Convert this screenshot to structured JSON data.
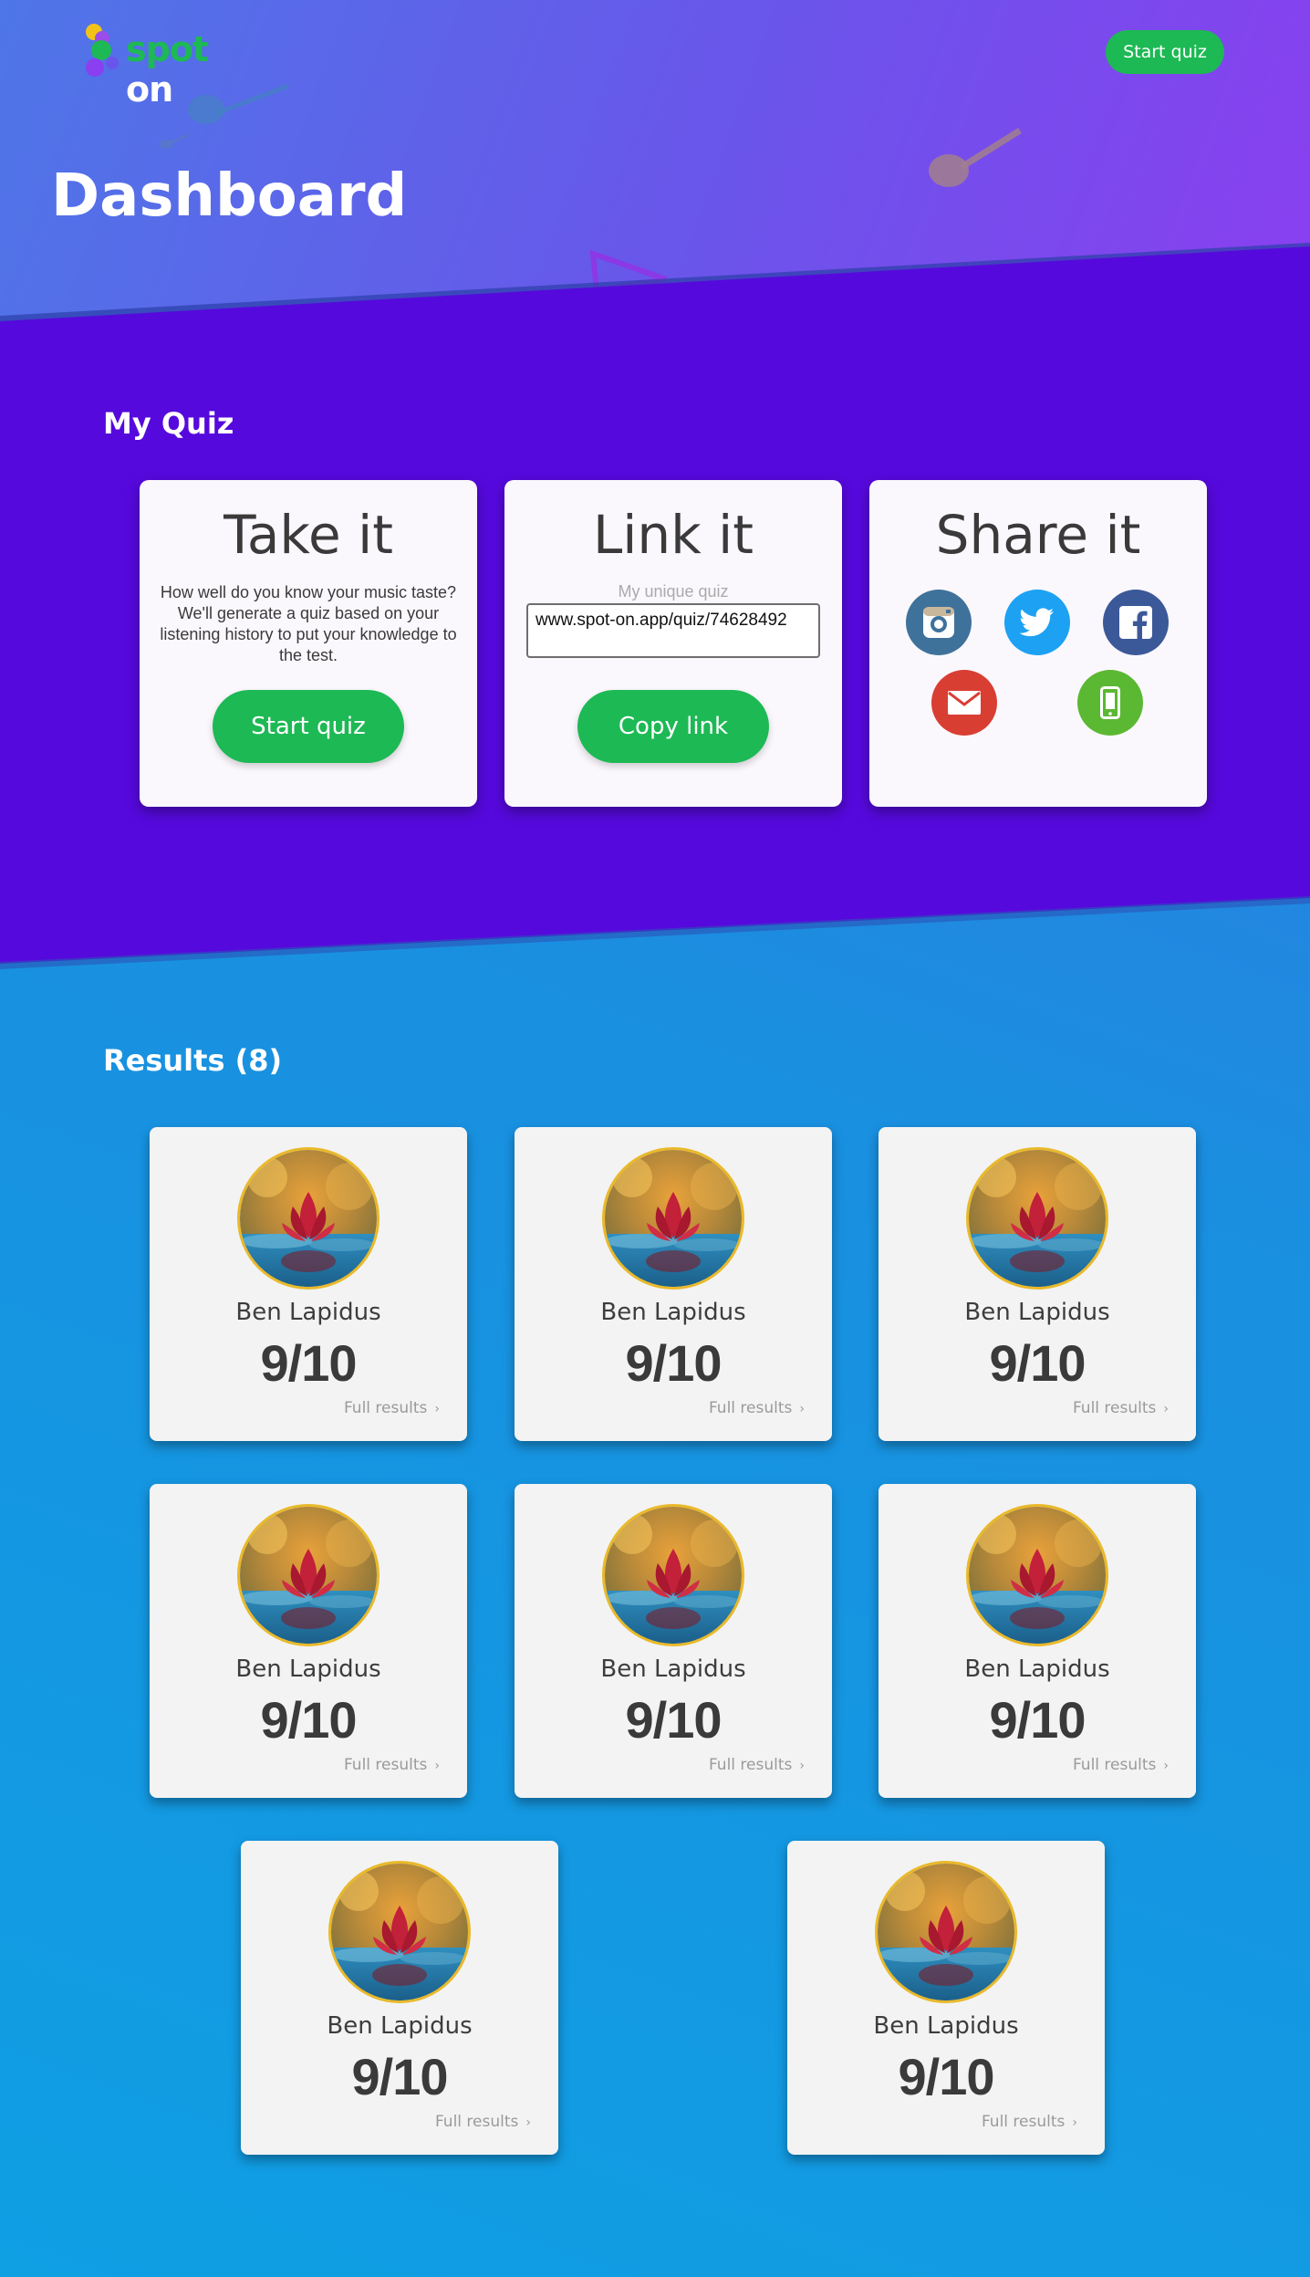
{
  "header": {
    "logo": {
      "part1": "spot",
      "part2": "on"
    },
    "start_quiz_label": "Start quiz",
    "page_title": "Dashboard"
  },
  "my_quiz": {
    "section_title": "My Quiz",
    "take_it": {
      "title": "Take it",
      "description": "How well do you know your music taste? We'll generate a quiz based on your listening history to put your knowledge to the test.",
      "button_label": "Start quiz"
    },
    "link_it": {
      "title": "Link it",
      "field_label": "My unique quiz",
      "link_value": "www.spot-on.app/quiz/74628492",
      "button_label": "Copy link"
    },
    "share_it": {
      "title": "Share it",
      "networks": [
        {
          "icon": "instagram-icon",
          "color": "#3f729b"
        },
        {
          "icon": "twitter-icon",
          "color": "#1da1f2"
        },
        {
          "icon": "facebook-icon",
          "color": "#3b5998"
        },
        {
          "icon": "email-icon",
          "color": "#d93e33"
        },
        {
          "icon": "phone-icon",
          "color": "#5bb832"
        }
      ]
    }
  },
  "results": {
    "section_title": "Results (8)",
    "items": [
      {
        "name": "Ben Lapidus",
        "score": "9/10",
        "link": "Full results"
      },
      {
        "name": "Ben Lapidus",
        "score": "9/10",
        "link": "Full results"
      },
      {
        "name": "Ben Lapidus",
        "score": "9/10",
        "link": "Full results"
      },
      {
        "name": "Ben Lapidus",
        "score": "9/10",
        "link": "Full results"
      },
      {
        "name": "Ben Lapidus",
        "score": "9/10",
        "link": "Full results"
      },
      {
        "name": "Ben Lapidus",
        "score": "9/10",
        "link": "Full results"
      },
      {
        "name": "Ben Lapidus",
        "score": "9/10",
        "link": "Full results"
      },
      {
        "name": "Ben Lapidus",
        "score": "9/10",
        "link": "Full results"
      }
    ]
  },
  "colors": {
    "accent_green": "#1db954",
    "band_purple": "#5609dd",
    "avatar_ring": "#e9b92a"
  }
}
